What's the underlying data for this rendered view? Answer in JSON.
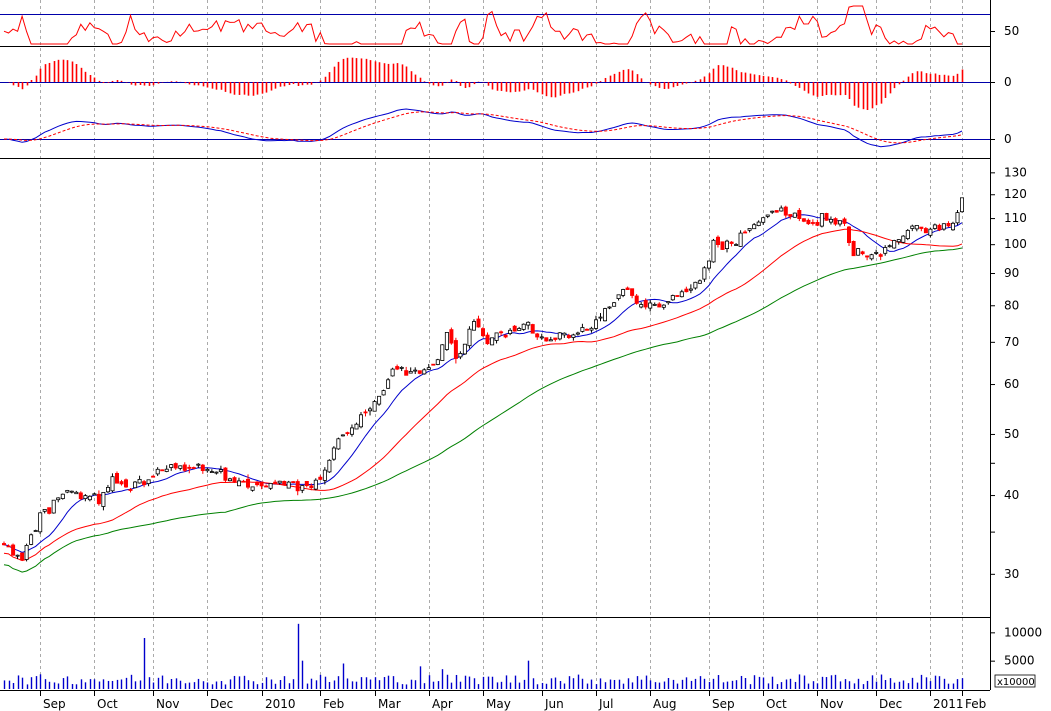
{
  "chart_data": {
    "type": "candlestick",
    "colors": {
      "up": "#000000",
      "down": "#ff0000",
      "ma_short": "#0000cc",
      "ma_mid": "#ff0000",
      "ma_long": "#008000",
      "volume": "#0000cc",
      "rsi": "#ff0000",
      "macd_hist": "#ff0000",
      "baseline": "#0000aa",
      "grid": "#aaaaaa"
    },
    "x_axis": {
      "month_labels": [
        "Sep",
        "Oct",
        "Nov",
        "Dec",
        "2010",
        "Feb",
        "Mar",
        "Apr",
        "May",
        "Jun",
        "Jul",
        "Aug",
        "Sep",
        "Oct",
        "Nov",
        "Dec",
        "2011",
        "Feb"
      ]
    },
    "rsi_panel": {
      "tick_labels": [
        "50"
      ],
      "levels": [
        70,
        50
      ]
    },
    "macd_hist_panel": {
      "tick_labels": [
        "0"
      ]
    },
    "macd_panel": {
      "tick_labels": [
        "0"
      ]
    },
    "price_panel": {
      "scale": "log",
      "ylim": [
        26,
        135
      ],
      "tick_labels": [
        "130",
        "120",
        "110",
        "100",
        "90",
        "80",
        "70",
        "60",
        "50",
        "40",
        "30"
      ],
      "minor_ticks": [
        35,
        45
      ]
    },
    "volume_panel": {
      "ylim": [
        0,
        12000
      ],
      "tick_labels": [
        "10000",
        "5000"
      ],
      "unit_label": "x10000"
    },
    "price_anchors": [
      [
        0,
        33
      ],
      [
        4,
        32
      ],
      [
        8,
        37
      ],
      [
        12,
        40
      ],
      [
        17,
        40
      ],
      [
        21,
        39
      ],
      [
        24,
        43
      ],
      [
        27,
        41
      ],
      [
        31,
        42
      ],
      [
        35,
        44
      ],
      [
        40,
        44
      ],
      [
        45,
        44
      ],
      [
        50,
        43
      ],
      [
        55,
        41
      ],
      [
        60,
        42
      ],
      [
        66,
        41
      ],
      [
        70,
        42
      ],
      [
        73,
        48
      ],
      [
        77,
        52
      ],
      [
        82,
        56
      ],
      [
        86,
        63
      ],
      [
        90,
        63
      ],
      [
        94,
        63
      ],
      [
        98,
        72
      ],
      [
        100,
        66
      ],
      [
        104,
        75
      ],
      [
        107,
        70
      ],
      [
        110,
        72
      ],
      [
        116,
        74
      ],
      [
        120,
        70
      ],
      [
        124,
        72
      ],
      [
        128,
        73
      ],
      [
        133,
        78
      ],
      [
        137,
        85
      ],
      [
        142,
        79
      ],
      [
        147,
        80
      ],
      [
        150,
        84
      ],
      [
        154,
        87
      ],
      [
        157,
        100
      ],
      [
        161,
        99
      ],
      [
        165,
        106
      ],
      [
        168,
        110
      ],
      [
        172,
        112
      ],
      [
        176,
        111
      ],
      [
        180,
        109
      ],
      [
        184,
        109
      ],
      [
        186,
        107
      ],
      [
        188,
        97
      ],
      [
        192,
        96
      ],
      [
        196,
        100
      ],
      [
        200,
        105
      ],
      [
        205,
        106
      ],
      [
        210,
        107
      ],
      [
        212,
        120
      ]
    ],
    "volume_spikes": [
      [
        31,
        9000
      ],
      [
        65,
        11500
      ],
      [
        66,
        5000
      ],
      [
        75,
        4500
      ],
      [
        92,
        4000
      ],
      [
        97,
        3500
      ],
      [
        116,
        5000
      ]
    ]
  }
}
